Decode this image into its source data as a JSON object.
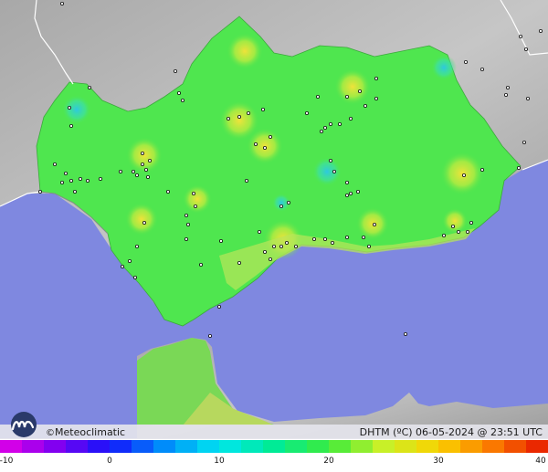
{
  "brand": {
    "copyright_symbol": "©",
    "name": "Meteoclimatic"
  },
  "title": {
    "variable": "DHTM (ºC)",
    "date": "06-05-2024",
    "at": "@",
    "time": "23:51 UTC"
  },
  "scale": {
    "min": -10,
    "max": 40,
    "step": 2,
    "labels": [
      "-10",
      "0",
      "10",
      "20",
      "30",
      "40"
    ],
    "label_values": [
      -10,
      0,
      10,
      20,
      30,
      40
    ]
  },
  "colors": {
    "sea": "#7f88e0",
    "land_outside": "#b8b8b8",
    "region_base": "#4fe64f",
    "warm_spot": "#e6e63a",
    "cool_spot": "#35d8c8",
    "coast_band": "#bde05a"
  },
  "icons": {
    "logo": "meteoclimatic-logo-icon"
  }
}
